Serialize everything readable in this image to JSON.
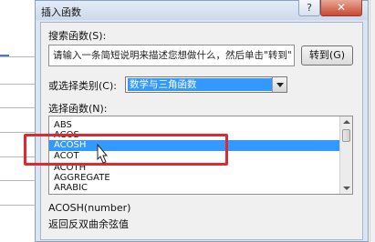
{
  "dialog": {
    "title": "插入函数",
    "help_label": "?",
    "close_label": "✕"
  },
  "search": {
    "label": "搜索函数(S):",
    "value": "请输入一条简短说明来描述您想做什么，然后单击\"转到\"",
    "goto_label": "转到(G)"
  },
  "category": {
    "label": "或选择类别(C):",
    "value": "数学与三角函数"
  },
  "function_list": {
    "label": "选择函数(N):",
    "items": [
      "ABS",
      "ACOS",
      "ACOSH",
      "ACOT",
      "ACOTH",
      "AGGREGATE",
      "ARABIC"
    ],
    "selected": "ACOSH"
  },
  "description": {
    "syntax": "ACOSH(number)",
    "text": "返回反双曲余弦值"
  },
  "colors": {
    "selection": "#3399ff",
    "highlight_box": "#e0282e"
  },
  "icons": [
    "help-icon",
    "close-icon",
    "dropdown-arrow-icon",
    "mouse-cursor-icon"
  ]
}
